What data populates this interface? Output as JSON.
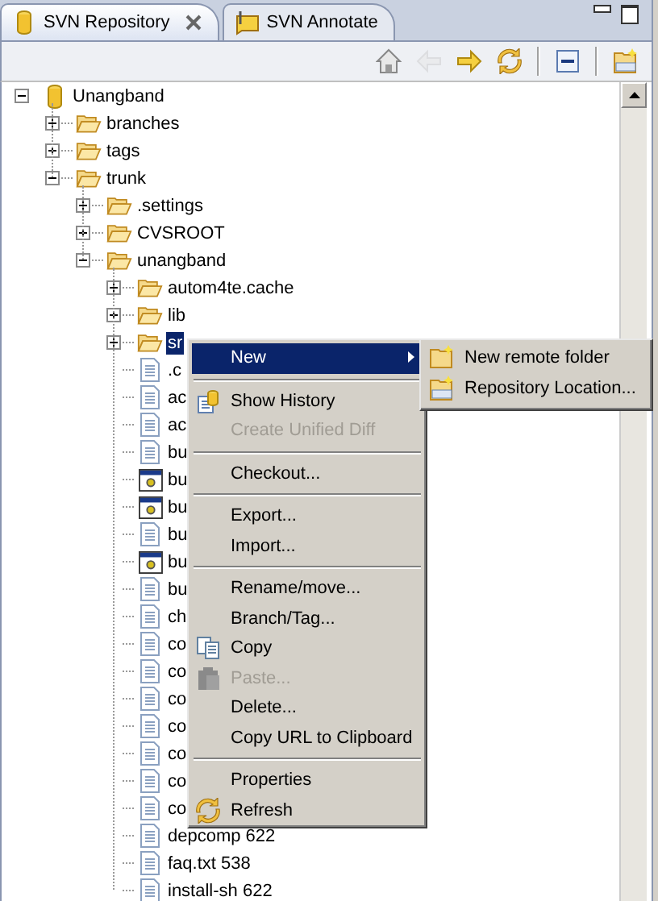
{
  "tabs": [
    {
      "label": "SVN Repository",
      "selected": true,
      "kind": "repository"
    },
    {
      "label": "SVN Annotate",
      "selected": false,
      "kind": "annotate"
    }
  ],
  "toolbar": [
    {
      "kind": "home",
      "disabled": false
    },
    {
      "kind": "back",
      "disabled": true
    },
    {
      "kind": "forward",
      "disabled": false
    },
    {
      "kind": "sync",
      "disabled": false
    },
    {
      "kind": "separator"
    },
    {
      "kind": "collapse",
      "disabled": false
    },
    {
      "kind": "separator"
    },
    {
      "kind": "new-location",
      "disabled": false
    }
  ],
  "tree": [
    {
      "label": "Unangband",
      "kind": "repository",
      "expanded": true,
      "selected": false,
      "children": [
        {
          "label": "branches",
          "kind": "folder",
          "expanded": false,
          "selected": false
        },
        {
          "label": "tags",
          "kind": "folder",
          "expanded": false,
          "selected": false
        },
        {
          "label": "trunk",
          "kind": "folder",
          "expanded": true,
          "selected": false,
          "children": [
            {
              "label": ".settings",
              "kind": "folder",
              "expanded": false,
              "selected": false
            },
            {
              "label": "CVSROOT",
              "kind": "folder",
              "expanded": false,
              "selected": false
            },
            {
              "label": "unangband",
              "kind": "folder",
              "expanded": true,
              "selected": false,
              "children": [
                {
                  "label": "autom4te.cache",
                  "kind": "folder",
                  "expanded": false,
                  "selected": false
                },
                {
                  "label": "lib",
                  "kind": "folder",
                  "expanded": false,
                  "selected": false
                },
                {
                  "label": "sr",
                  "kind": "folder",
                  "expanded": false,
                  "selected": true
                },
                {
                  "label": ".c",
                  "kind": "file",
                  "selected": false
                },
                {
                  "label": "ac",
                  "kind": "file",
                  "selected": false
                },
                {
                  "label": "ac",
                  "kind": "file",
                  "selected": false
                },
                {
                  "label": "bu",
                  "kind": "file",
                  "selected": false
                },
                {
                  "label": "bu",
                  "kind": "executable",
                  "selected": false
                },
                {
                  "label": "bu",
                  "kind": "executable",
                  "selected": false
                },
                {
                  "label": "bu",
                  "kind": "file",
                  "selected": false
                },
                {
                  "label": "bu",
                  "kind": "executable",
                  "selected": false
                },
                {
                  "label": "bu",
                  "kind": "file",
                  "selected": false
                },
                {
                  "label": "ch",
                  "kind": "file",
                  "selected": false
                },
                {
                  "label": "co",
                  "kind": "file",
                  "selected": false
                },
                {
                  "label": "co",
                  "kind": "file",
                  "selected": false
                },
                {
                  "label": "co",
                  "kind": "file",
                  "selected": false
                },
                {
                  "label": "co",
                  "kind": "file",
                  "selected": false
                },
                {
                  "label": "co",
                  "kind": "file",
                  "selected": false
                },
                {
                  "label": "co",
                  "kind": "file",
                  "selected": false
                },
                {
                  "label": "co",
                  "kind": "file",
                  "selected": false
                },
                {
                  "label": "depcomp 622",
                  "kind": "file",
                  "selected": false
                },
                {
                  "label": "faq.txt 538",
                  "kind": "file",
                  "selected": false
                },
                {
                  "label": "install-sh 622",
                  "kind": "file",
                  "selected": false
                }
              ]
            }
          ]
        }
      ]
    }
  ],
  "context_menu": [
    {
      "kind": "item",
      "label": "New",
      "selected": true,
      "disabled": false,
      "submenu": true
    },
    {
      "kind": "separator"
    },
    {
      "kind": "item",
      "label": "Show History",
      "selected": false,
      "disabled": false
    },
    {
      "kind": "item",
      "label": "Create Unified Diff",
      "selected": false,
      "disabled": true
    },
    {
      "kind": "separator"
    },
    {
      "kind": "item",
      "label": "Checkout...",
      "selected": false,
      "disabled": false
    },
    {
      "kind": "separator"
    },
    {
      "kind": "item",
      "label": "Export...",
      "selected": false,
      "disabled": false
    },
    {
      "kind": "item",
      "label": "Import...",
      "selected": false,
      "disabled": false
    },
    {
      "kind": "separator"
    },
    {
      "kind": "item",
      "label": "Rename/move...",
      "selected": false,
      "disabled": false
    },
    {
      "kind": "item",
      "label": "Branch/Tag...",
      "selected": false,
      "disabled": false
    },
    {
      "kind": "item",
      "label": "Copy",
      "selected": false,
      "disabled": false
    },
    {
      "kind": "item",
      "label": "Paste...",
      "selected": false,
      "disabled": true
    },
    {
      "kind": "item",
      "label": "Delete...",
      "selected": false,
      "disabled": false
    },
    {
      "kind": "item",
      "label": "Copy URL to Clipboard",
      "selected": false,
      "disabled": false
    },
    {
      "kind": "separator"
    },
    {
      "kind": "item",
      "label": "Properties",
      "selected": false,
      "disabled": false
    },
    {
      "kind": "item",
      "label": "Refresh",
      "selected": false,
      "disabled": false
    }
  ],
  "submenu": [
    {
      "kind": "item",
      "label": "New remote folder",
      "selected": false,
      "disabled": false
    },
    {
      "kind": "item",
      "label": "Repository Location...",
      "selected": false,
      "disabled": false
    }
  ]
}
